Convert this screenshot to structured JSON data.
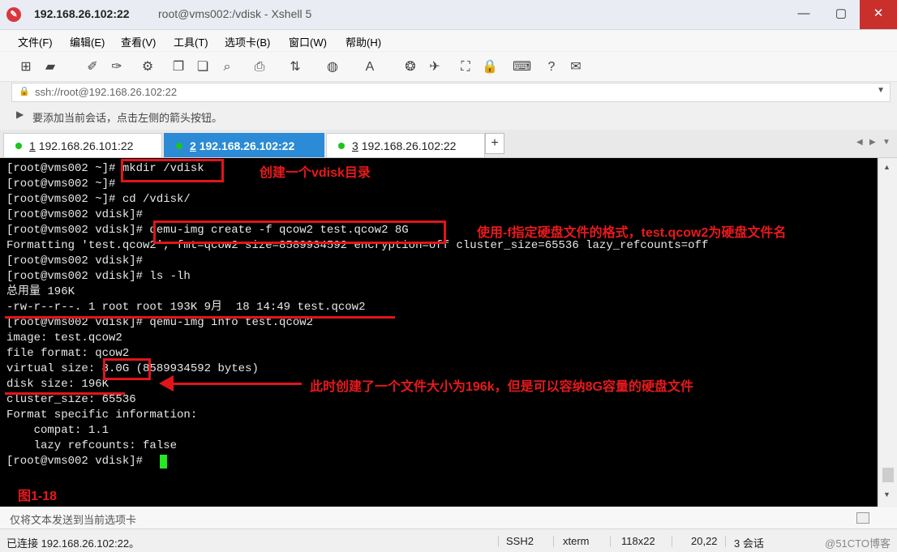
{
  "window": {
    "app_icon_glyph": "✎",
    "title_host": "192.168.26.102:22",
    "title_rest": "root@vms002:/vdisk - Xshell 5",
    "minimize": "—",
    "maximize": "▢",
    "close": "✕"
  },
  "menu": [
    "文件(F)",
    "编辑(E)",
    "查看(V)",
    "工具(T)",
    "选项卡(B)",
    "窗口(W)",
    "帮助(H)"
  ],
  "toolbar_icons": [
    {
      "name": "new-session-icon",
      "glyph": "⊞"
    },
    {
      "name": "open-folder-icon",
      "glyph": "▰"
    },
    {
      "name": "connect-icon",
      "glyph": "✐"
    },
    {
      "name": "disconnect-icon",
      "glyph": "✑"
    },
    {
      "name": "properties-icon",
      "glyph": "⚙"
    },
    {
      "name": "copy-icon",
      "glyph": "❐"
    },
    {
      "name": "paste-icon",
      "glyph": "❏"
    },
    {
      "name": "find-icon",
      "glyph": "⌕"
    },
    {
      "name": "print-icon",
      "glyph": "⎙"
    },
    {
      "name": "transfer-icon",
      "glyph": "⇅"
    },
    {
      "name": "globe-icon",
      "glyph": "◍"
    },
    {
      "name": "font-icon",
      "glyph": "A"
    },
    {
      "name": "xftp-icon",
      "glyph": "❂"
    },
    {
      "name": "xmanager-icon",
      "glyph": "✈"
    },
    {
      "name": "fullscreen-icon",
      "glyph": "⛶"
    },
    {
      "name": "lock-icon",
      "glyph": "🔒"
    },
    {
      "name": "keyboard-icon",
      "glyph": "⌨"
    },
    {
      "name": "help-icon",
      "glyph": "?"
    },
    {
      "name": "chat-icon",
      "glyph": "✉"
    }
  ],
  "address": {
    "lock_glyph": "🔒",
    "value": "ssh://root@192.168.26.102:22",
    "dropdown": "▼"
  },
  "hint": {
    "icon": "▶",
    "text": "要添加当前会话，点击左侧的箭头按钮。"
  },
  "tabs": [
    {
      "index": "1",
      "host": "192.168.26.101:22"
    },
    {
      "index": "2",
      "host": "192.168.26.102:22"
    },
    {
      "index": "3",
      "host": "192.168.26.102:22"
    }
  ],
  "tab_add": "+",
  "tab_nav": {
    "prev": "◀",
    "next": "▶",
    "menu": "▼"
  },
  "terminal": {
    "lines": [
      "[root@vms002 ~]# mkdir /vdisk",
      "[root@vms002 ~]#",
      "[root@vms002 ~]# cd /vdisk/",
      "[root@vms002 vdisk]#",
      "[root@vms002 vdisk]# qemu-img create -f qcow2 test.qcow2 8G",
      "Formatting 'test.qcow2', fmt=qcow2 size=8589934592 encryption=off cluster_size=65536 lazy_refcounts=off",
      "[root@vms002 vdisk]#",
      "[root@vms002 vdisk]# ls -lh",
      "总用量 196K",
      "-rw-r--r--. 1 root root 193K 9月  18 14:49 test.qcow2",
      "[root@vms002 vdisk]# qemu-img info test.qcow2",
      "image: test.qcow2",
      "file format: qcow2",
      "virtual size: 8.0G (8589934592 bytes)",
      "disk size: 196K",
      "cluster_size: 65536",
      "Format specific information:",
      "    compat: 1.1",
      "    lazy refcounts: false",
      "[root@vms002 vdisk]# "
    ]
  },
  "annotations": {
    "mkdir_note": "创建一个vdisk目录",
    "create_note": "使用-f指定硬盘文件的格式，test.qcow2为硬盘文件名",
    "size_note": "此时创建了一个文件大小为196k，但是可以容纳8G容量的硬盘文件",
    "figure_label": "图1-18",
    "color": "#e0151b"
  },
  "send_bar": {
    "text": "仅将文本发送到当前选项卡"
  },
  "status": {
    "connection": "已连接 192.168.26.102:22。",
    "protocol": "SSH2",
    "terminal_type": "xterm",
    "size": "118x22",
    "position": "20,22",
    "sessions": "3 会话",
    "watermark": "@51CTO博客"
  }
}
